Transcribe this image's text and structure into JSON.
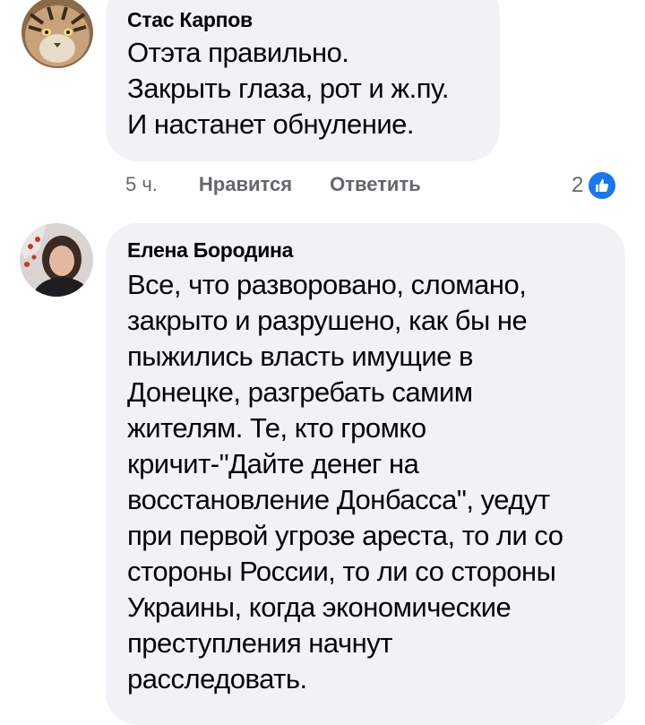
{
  "comments": [
    {
      "author": "Стас Карпов",
      "lines": [
        "Отэта правильно.",
        "Закрыть глаза, рот и ж.пу.",
        "И настанет обнуление."
      ],
      "time": "5 ч.",
      "like_label": "Нравится",
      "reply_label": "Ответить",
      "reaction_count": "2",
      "reaction_icon": "thumbs-up-icon"
    },
    {
      "author": "Елена Бородина",
      "lines": [
        "Все, что разворовано, сломано,",
        "закрыто и разрушено, как бы не",
        "пыжились власть имущие в",
        "Донецке, разгребать самим",
        "жителям. Те, кто громко",
        "кричит-\"Дайте денег на",
        "восстановление Донбасса\", уедут",
        "при первой угрозе ареста, то ли со",
        "стороны России, то ли со стороны",
        "Украины, когда экономические",
        "преступления начнут",
        "расследовать."
      ]
    }
  ],
  "colors": {
    "bubble": "#f0f2f5",
    "meta_text": "#65676b",
    "like_blue": "#1877f2"
  }
}
